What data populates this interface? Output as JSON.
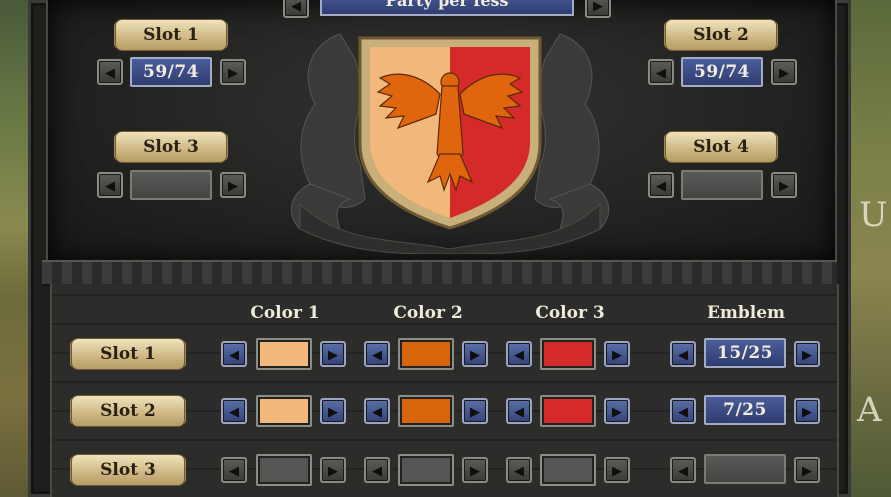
{
  "colors": {
    "panel_blue": "#34437a",
    "scroll_tan": "#cdb682",
    "color1": "#f2b77a",
    "color2": "#d8640c",
    "color3": "#d42a2a",
    "empty": "#555553"
  },
  "shield_variant": {
    "label": "Party per fess",
    "prev_icon": "left-arrow-icon",
    "next_icon": "right-arrow-icon"
  },
  "upper_slots": [
    {
      "label": "Slot 1",
      "value": "59/74"
    },
    {
      "label": "Slot 2",
      "value": "59/74"
    },
    {
      "label": "Slot 3",
      "value": ""
    },
    {
      "label": "Slot 4",
      "value": ""
    }
  ],
  "table": {
    "headers": [
      "Color 1",
      "Color 2",
      "Color 3",
      "Emblem"
    ],
    "rows": [
      {
        "label": "Slot 1",
        "colors": [
          "#f2b77a",
          "#d8640c",
          "#d42a2a"
        ],
        "emblem": "15/25"
      },
      {
        "label": "Slot 2",
        "colors": [
          "#f2b77a",
          "#d8640c",
          "#d42a2a"
        ],
        "emblem": "7/25"
      },
      {
        "label": "Slot 3",
        "colors": [
          "",
          "",
          ""
        ],
        "emblem": ""
      }
    ]
  },
  "arrows": {
    "left": "◀",
    "right": "▶"
  }
}
